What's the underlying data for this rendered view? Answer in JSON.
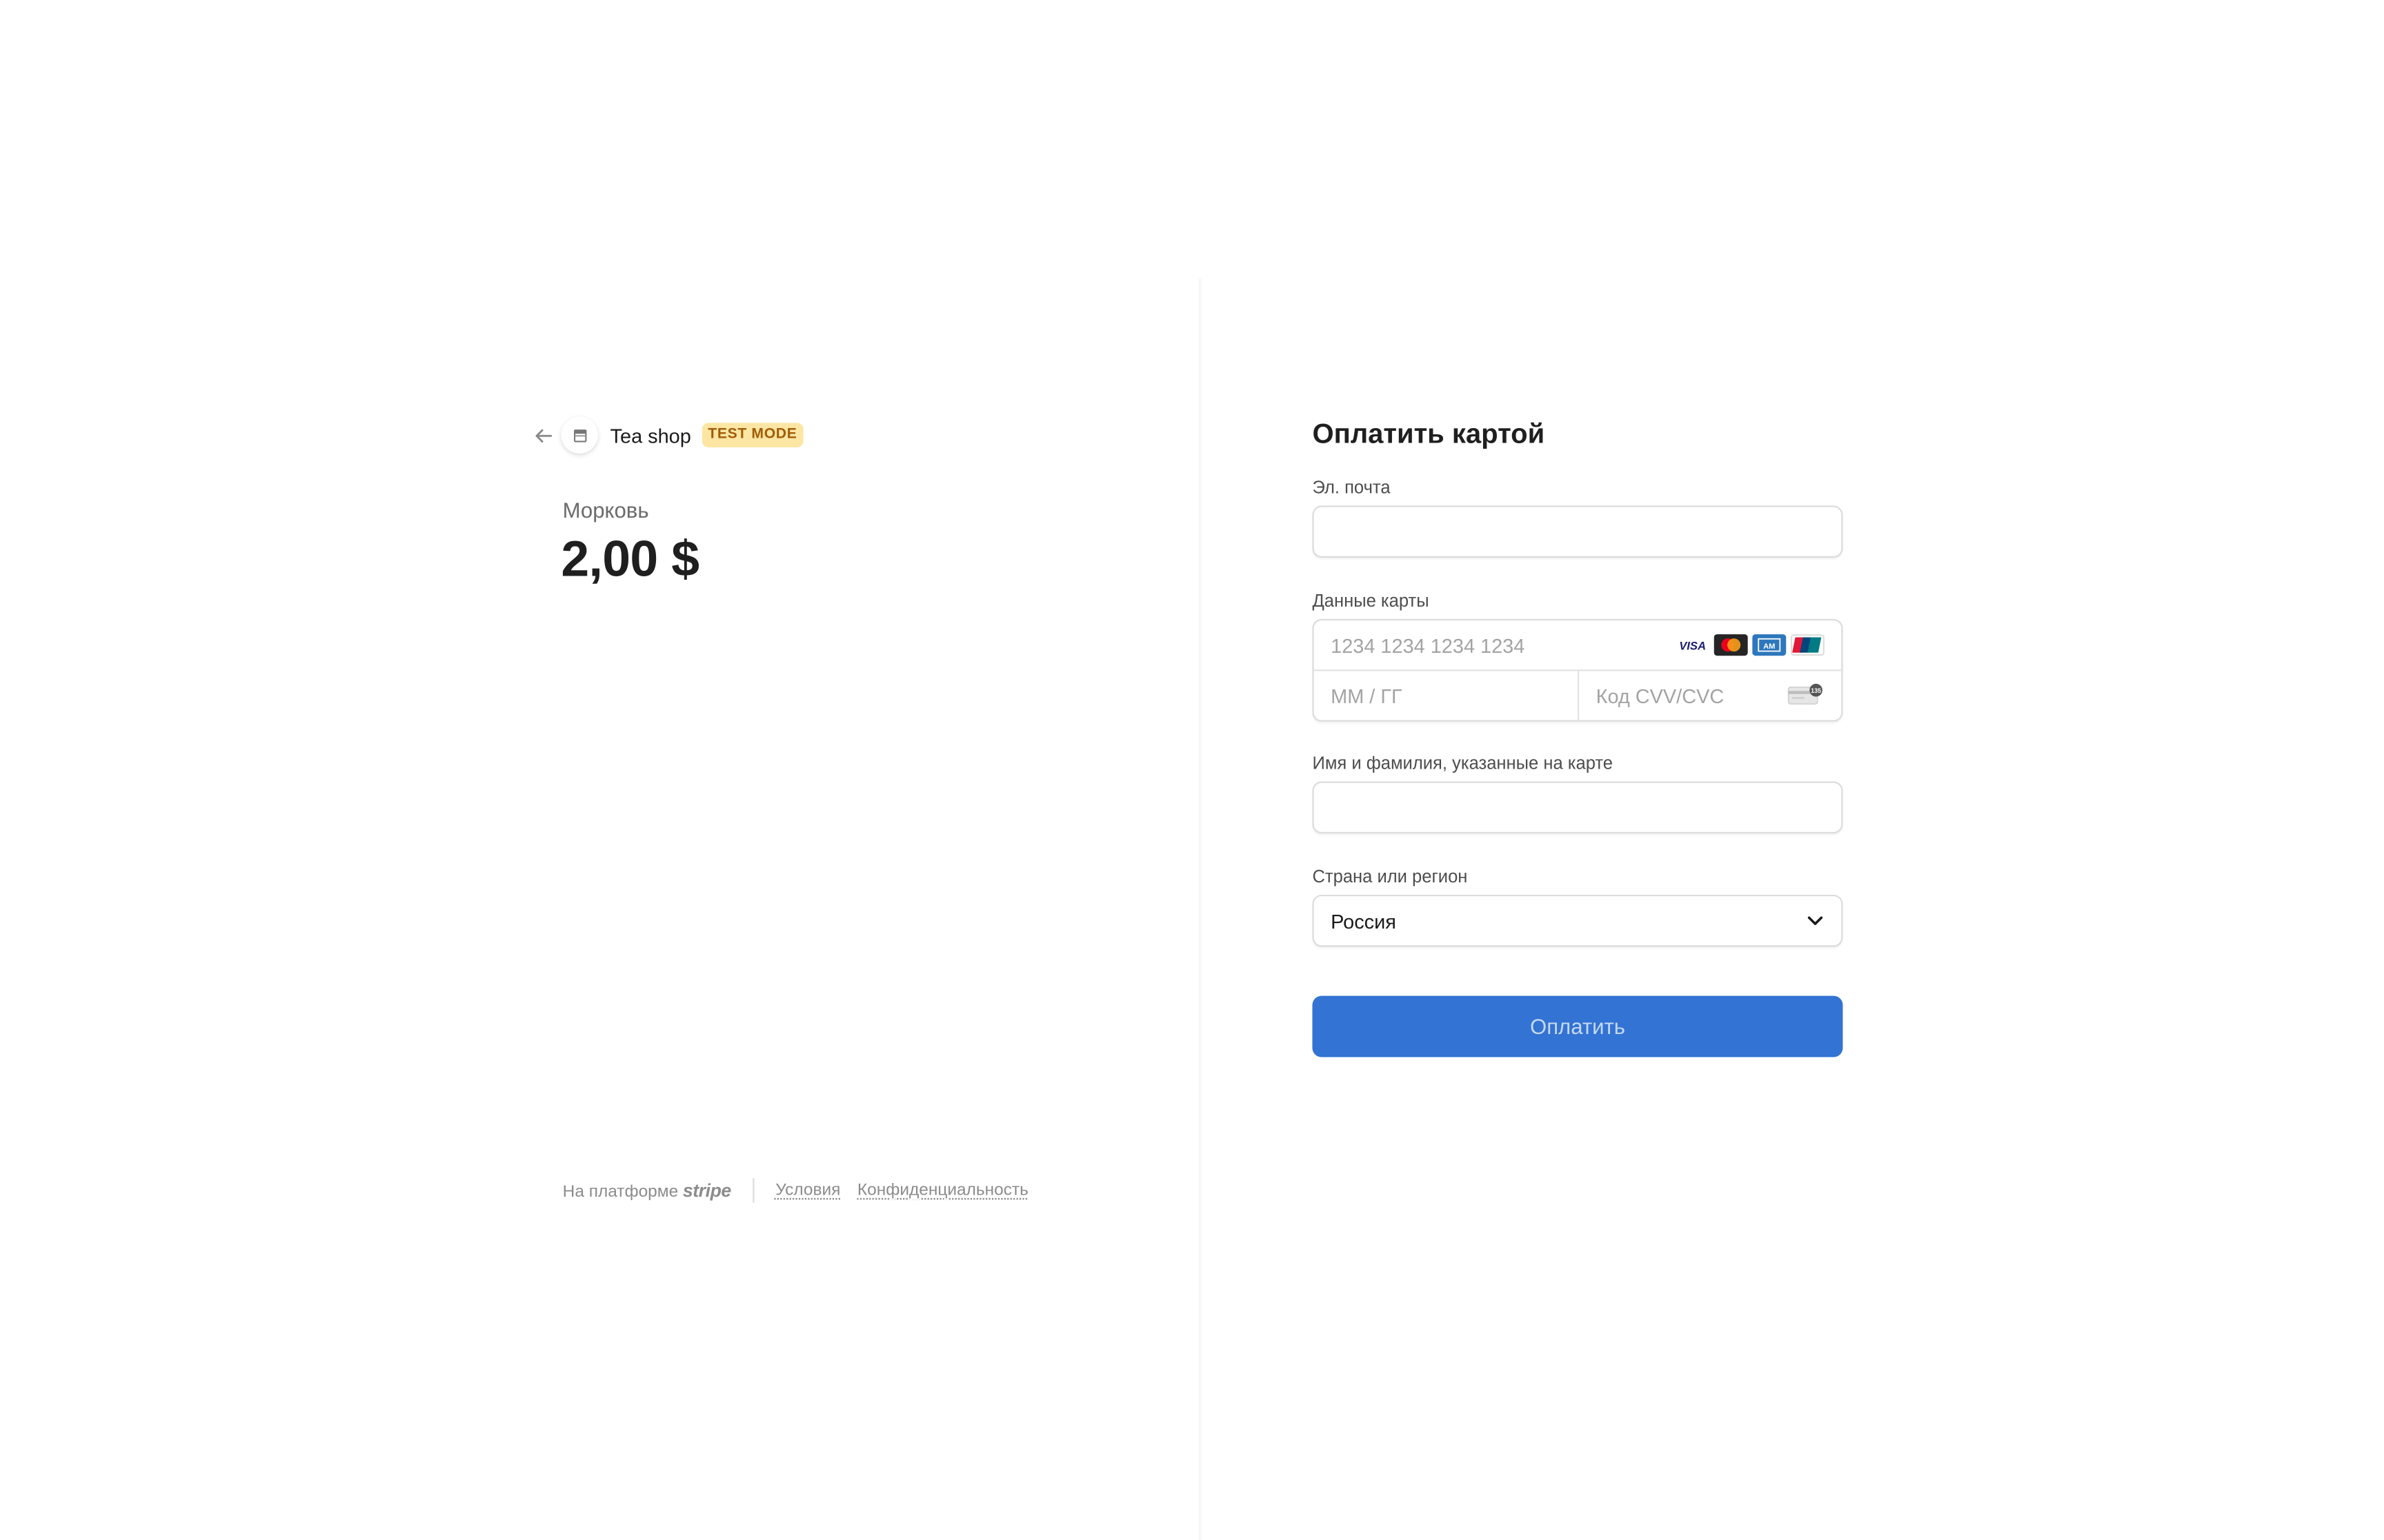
{
  "merchant": {
    "name": "Tea shop",
    "test_badge": "TEST MODE"
  },
  "product": {
    "name": "Морковь",
    "price": "2,00 $"
  },
  "footer": {
    "powered_by": "На платформе",
    "brand": "stripe",
    "terms_link": "Условия",
    "privacy_link": "Конфиденциальность"
  },
  "form": {
    "title": "Оплатить картой",
    "email": {
      "label": "Эл. почта",
      "value": "",
      "placeholder": ""
    },
    "card": {
      "label": "Данные карты",
      "number_placeholder": "1234 1234 1234 1234",
      "expiry_placeholder": "ММ / ГГ",
      "cvc_placeholder": "Код CVV/CVC",
      "brands": [
        "visa-icon",
        "mastercard-icon",
        "amex-icon",
        "unionpay-icon"
      ]
    },
    "cardholder": {
      "label": "Имя и фамилия, указанные на карте",
      "value": ""
    },
    "country": {
      "label": "Страна или регион",
      "selected": "Россия"
    },
    "submit_label": "Оплатить"
  },
  "colors": {
    "accent": "#3273d3",
    "button_text": "#c5d8f4",
    "badge_bg": "#fde6a3",
    "badge_text": "#a15c07"
  }
}
